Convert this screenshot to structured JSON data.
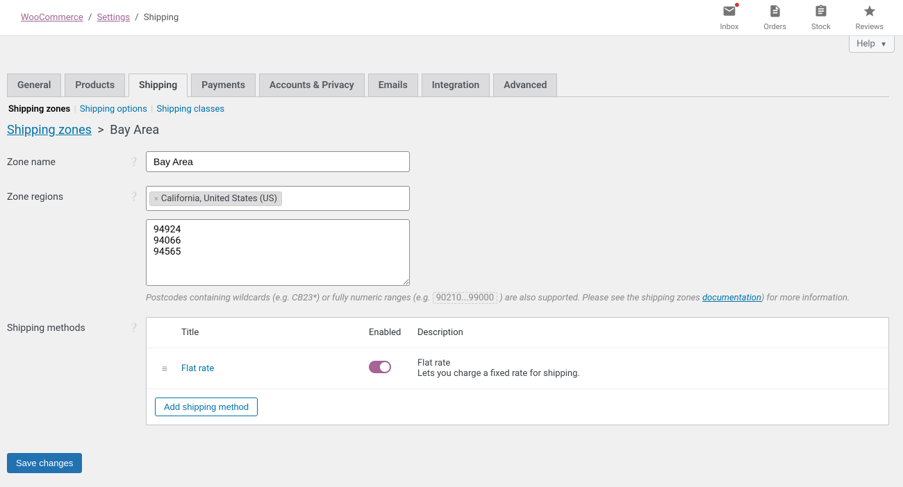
{
  "breadcrumb": {
    "root": "WooCommerce",
    "mid": "Settings",
    "current": "Shipping"
  },
  "topbar": {
    "inbox": "Inbox",
    "orders": "Orders",
    "stock": "Stock",
    "reviews": "Reviews"
  },
  "help": {
    "label": "Help"
  },
  "tabs": [
    "General",
    "Products",
    "Shipping",
    "Payments",
    "Accounts & Privacy",
    "Emails",
    "Integration",
    "Advanced"
  ],
  "active_tab": "Shipping",
  "subtabs": {
    "zones": "Shipping zones",
    "options": "Shipping options",
    "classes": "Shipping classes"
  },
  "heading": {
    "link": "Shipping zones",
    "current": "Bay Area"
  },
  "form": {
    "zone_name": {
      "label": "Zone name",
      "value": "Bay Area"
    },
    "zone_regions": {
      "label": "Zone regions",
      "tag": "California, United States (US)",
      "postcodes": "94924\n94066\n94565",
      "hint_pre": "Postcodes containing wildcards (e.g. CB23*) or fully numeric ranges (e.g. ",
      "hint_code": "90210...99000",
      "hint_mid": ") are also supported. Please see the shipping zones ",
      "hint_link": "documentation",
      "hint_post": ") for more information."
    },
    "shipping_methods": {
      "label": "Shipping methods"
    }
  },
  "methods": {
    "cols": {
      "title": "Title",
      "enabled": "Enabled",
      "desc": "Description"
    },
    "rows": [
      {
        "title": "Flat rate",
        "desc_title": "Flat rate",
        "desc_text": "Lets you charge a fixed rate for shipping."
      }
    ],
    "add": "Add shipping method"
  },
  "save": "Save changes"
}
